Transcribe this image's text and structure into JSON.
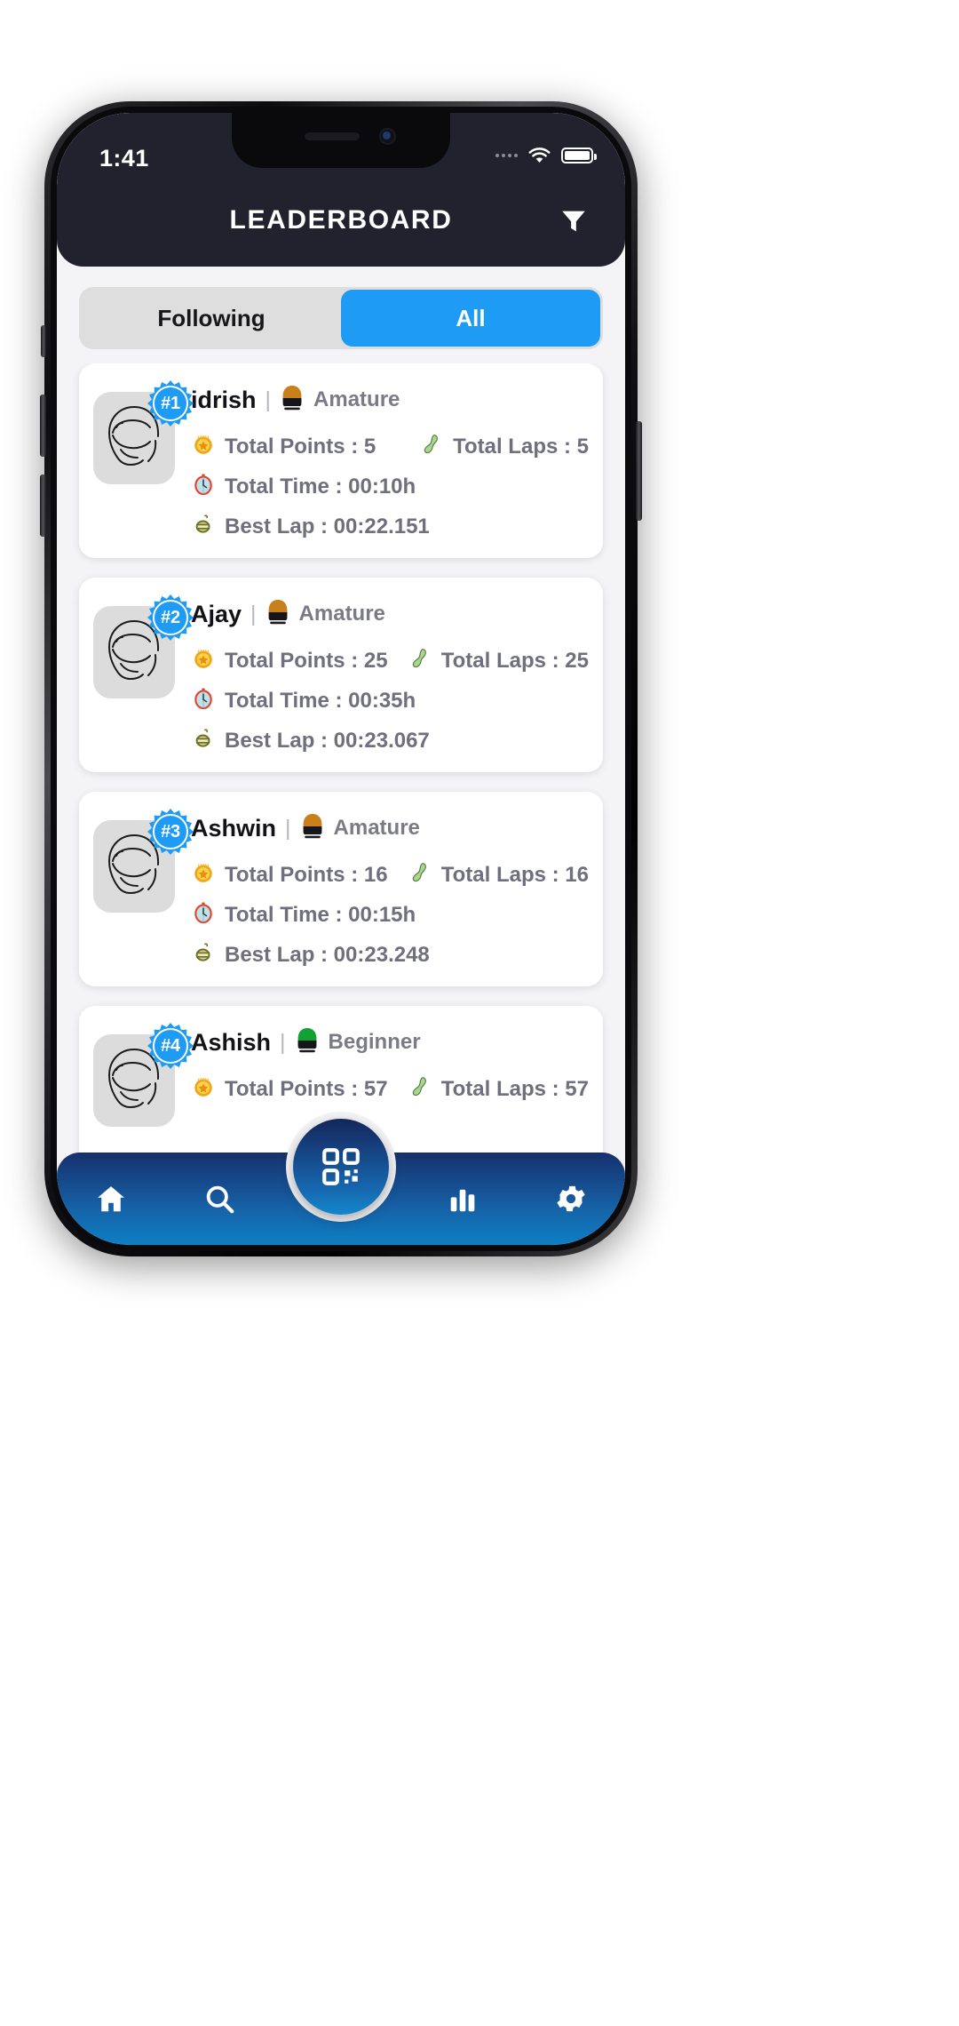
{
  "status_bar": {
    "time": "1:41",
    "signal_icon": "signal-dots-icon",
    "wifi_icon": "wifi-icon",
    "battery_icon": "battery-full-icon"
  },
  "header": {
    "title": "LEADERBOARD",
    "filter_icon": "filter-funnel-icon"
  },
  "tabs": {
    "items": [
      {
        "label": "Following",
        "active": false
      },
      {
        "label": "All",
        "active": true
      }
    ],
    "active_color": "#1e9cf5",
    "inactive_bg": "#dedede"
  },
  "labels": {
    "points": "Total Points :",
    "laps": "Total Laps :",
    "time": "Total Time :",
    "best_lap": "Best Lap :",
    "separator": "|"
  },
  "icons": {
    "points": "🪙",
    "laps": "🥒",
    "time": "⏱️",
    "best_lap": "⏲️",
    "helmet_orange": "🏈",
    "helmet_green": "🍏"
  },
  "leaderboard": [
    {
      "rank": "#1",
      "name": "idrish",
      "level": "Amature",
      "helmet_color": "#c9801a",
      "total_points": "5",
      "total_laps": "5",
      "total_time": "00:10h",
      "best_lap": "00:22.151"
    },
    {
      "rank": "#2",
      "name": "Ajay",
      "level": "Amature",
      "helmet_color": "#c9801a",
      "total_points": "25",
      "total_laps": "25",
      "total_time": "00:35h",
      "best_lap": "00:23.067"
    },
    {
      "rank": "#3",
      "name": "Ashwin",
      "level": "Amature",
      "helmet_color": "#c9801a",
      "total_points": "16",
      "total_laps": "16",
      "total_time": "00:15h",
      "best_lap": "00:23.248"
    },
    {
      "rank": "#4",
      "name": "Ashish",
      "level": "Beginner",
      "helmet_color": "#12a133",
      "total_points": "57",
      "total_laps": "57",
      "total_time": "",
      "best_lap": ""
    }
  ],
  "bottom_nav": {
    "items": [
      {
        "icon": "home-icon",
        "name": "home"
      },
      {
        "icon": "search-icon",
        "name": "search"
      },
      {
        "icon": "qr-scan-icon",
        "name": "scan"
      },
      {
        "icon": "bar-chart-icon",
        "name": "stats"
      },
      {
        "icon": "gear-icon",
        "name": "settings"
      }
    ]
  }
}
